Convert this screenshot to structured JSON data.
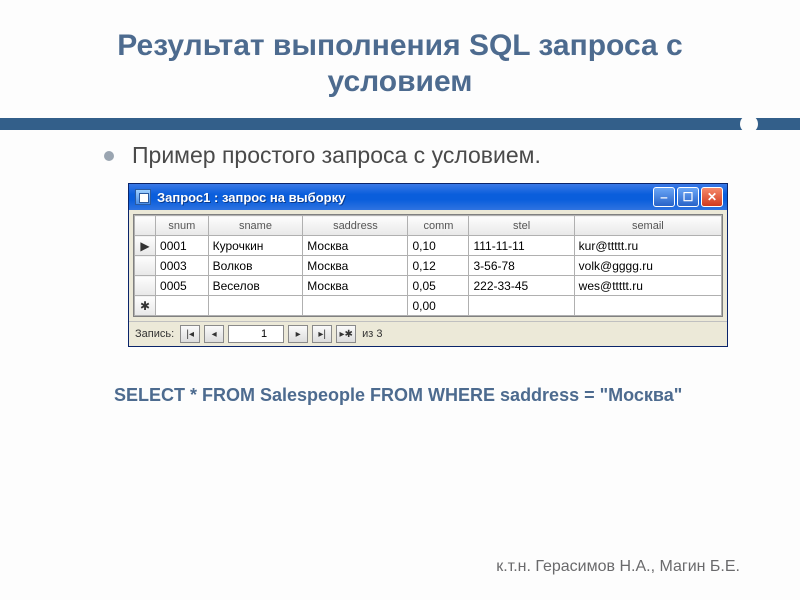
{
  "title": "Результат выполнения SQL запроса с условием",
  "bullet": "Пример простого запроса с условием.",
  "window": {
    "title": "Запрос1 : запрос на выборку",
    "columns": [
      "snum",
      "sname",
      "saddress",
      "comm",
      "stel",
      "semail"
    ],
    "rows": [
      {
        "snum": "0001",
        "sname": "Курочкин",
        "saddress": "Москва",
        "comm": "0,10",
        "stel": "111-11-11",
        "semail": "kur@ttttt.ru"
      },
      {
        "snum": "0003",
        "sname": "Волков",
        "saddress": "Москва",
        "comm": "0,12",
        "stel": "3-56-78",
        "semail": "volk@gggg.ru"
      },
      {
        "snum": "0005",
        "sname": "Веселов",
        "saddress": "Москва",
        "comm": "0,05",
        "stel": "222-33-45",
        "semail": "wes@ttttt.ru"
      }
    ],
    "new_row_comm": "0,00",
    "nav": {
      "label": "Запись:",
      "current": "1",
      "total": "из 3"
    }
  },
  "sql": "SELECT * FROM Salespeople FROM WHERE saddress = \"Москва\"",
  "footer": "к.т.н. Герасимов Н.А., Магин Б.Е."
}
